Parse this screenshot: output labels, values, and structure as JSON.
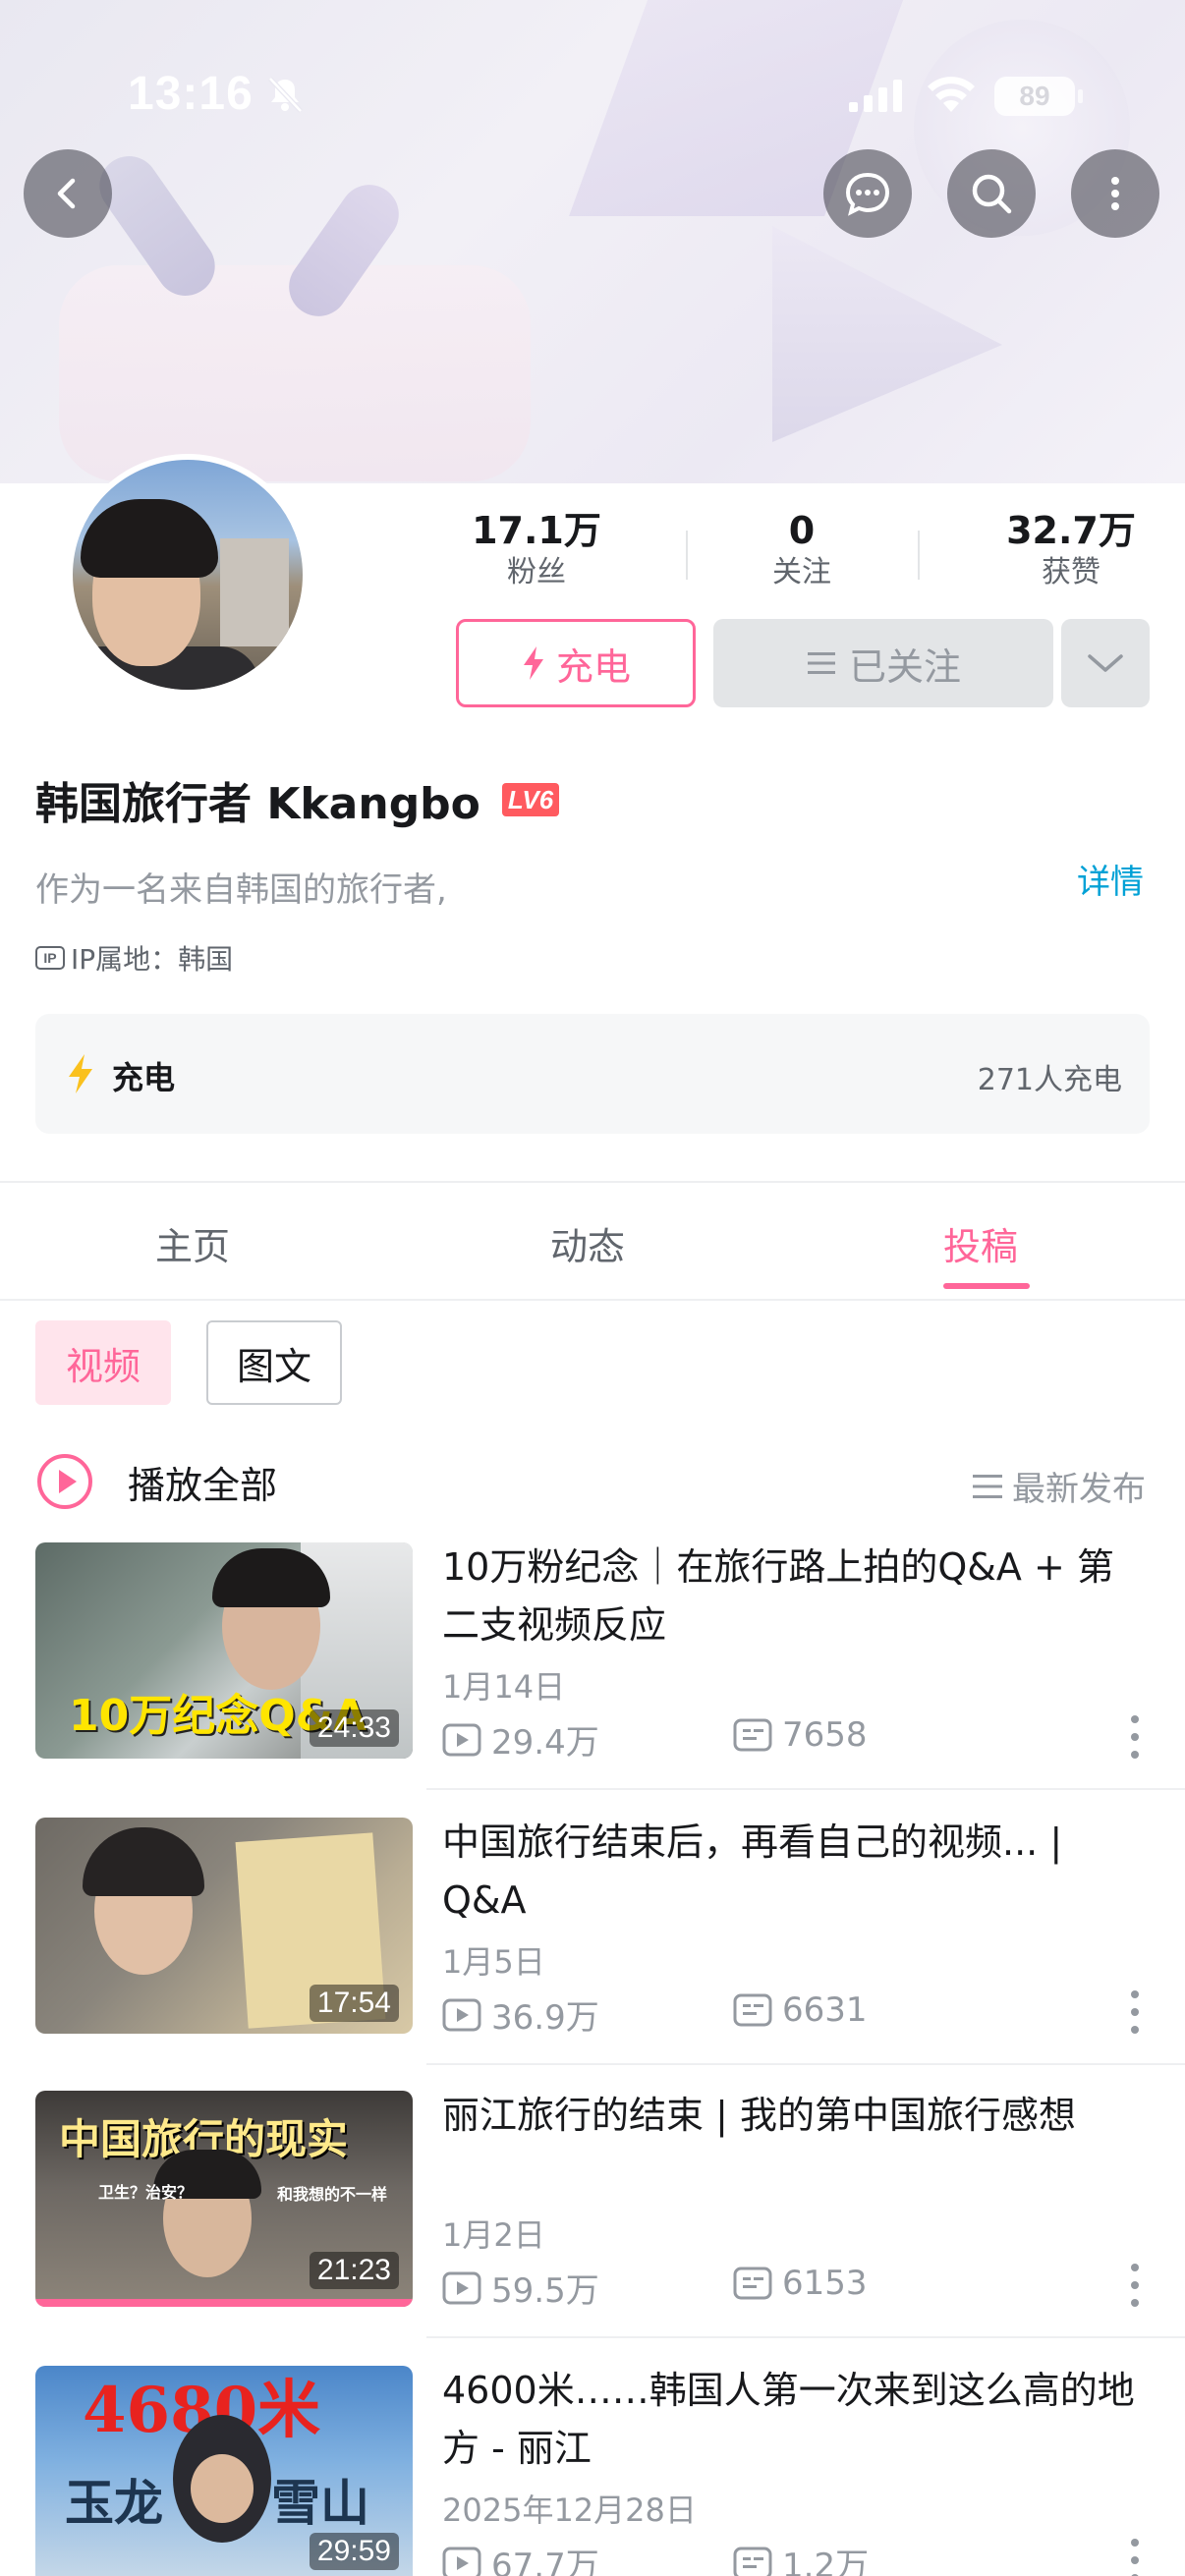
{
  "status_bar": {
    "time": "13:16",
    "battery": "89"
  },
  "colors": {
    "accent": "#ff6699",
    "link": "#00a1d6",
    "text_primary": "#18191c",
    "text_secondary": "#9499a0"
  },
  "profile": {
    "stats": [
      {
        "value": "17.1万",
        "label": "粉丝"
      },
      {
        "value": "0",
        "label": "关注"
      },
      {
        "value": "32.7万",
        "label": "获赞"
      }
    ],
    "charge_button": "充电",
    "followed_button": "已关注",
    "name": "韩国旅行者 Kkangbo",
    "level": "LV6",
    "bio": "作为一名来自韩国的旅行者,",
    "detail_link": "详情",
    "ip_label": "IP属地：韩国",
    "ip_icon_text": "IP",
    "charge_box": {
      "label": "充电",
      "count": "271人充电"
    }
  },
  "tabs": [
    {
      "label": "主页"
    },
    {
      "label": "动态"
    },
    {
      "label": "投稿"
    }
  ],
  "filters": {
    "video": "视频",
    "text": "图文"
  },
  "list_header": {
    "play_all": "播放全部",
    "sort": "最新发布"
  },
  "videos": [
    {
      "title": "10万粉纪念｜在旅行路上拍的Q&A + 第二支视频反应",
      "date": "1月14日",
      "views": "29.4万",
      "comments": "7658",
      "duration": "24:33",
      "thumb_text": "10万纪念Q&A"
    },
    {
      "title": "中国旅行结束后，再看自己的视频... | Q&A",
      "date": "1月5日",
      "views": "36.9万",
      "comments": "6631",
      "duration": "17:54",
      "thumb_text": ""
    },
    {
      "title": "丽江旅行的结束 | 我的第中国旅行感想",
      "date": "1月2日",
      "views": "59.5万",
      "comments": "6153",
      "duration": "21:23",
      "thumb_text": "中国旅行的现实",
      "thumb_sub1": "卫生？治安？",
      "thumb_sub2": "和我想的不一样"
    },
    {
      "title": "4600米……韩国人第一次来到这么高的地方 - 丽江",
      "date": "2025年12月28日",
      "views": "67.7万",
      "comments": "1.2万",
      "duration": "29:59",
      "thumb_text": "4680米",
      "thumb_sub1": "玉龙",
      "thumb_sub2": "雪山"
    }
  ]
}
